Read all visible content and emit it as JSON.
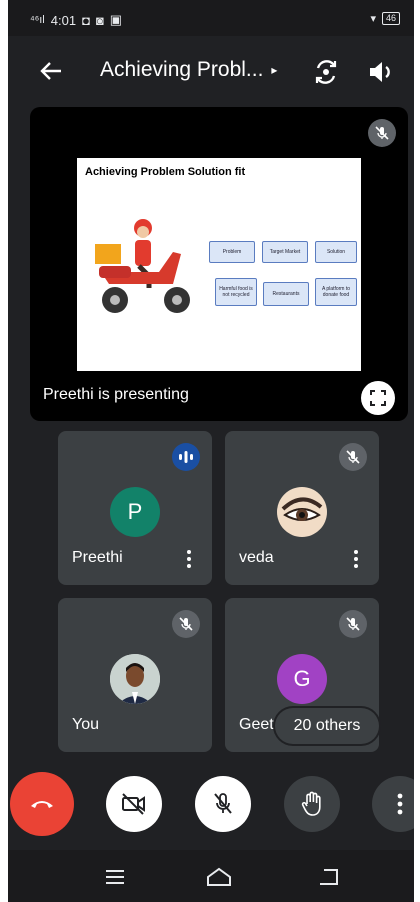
{
  "status_bar": {
    "time": "4:01",
    "signal": "⁴⁶ıl",
    "battery": "46"
  },
  "app_bar": {
    "title": "Achieving Probl...",
    "caret": "▸"
  },
  "presentation": {
    "presenting_label": "Preethi is presenting",
    "slide": {
      "title": "Achieving Problem Solution fit",
      "boxes": [
        "Problem",
        "Target Market",
        "Solution",
        "Harmful food is not recycled",
        "Restaurants",
        "A platform to donate food"
      ]
    }
  },
  "participants": [
    {
      "name": "Preethi",
      "initial": "P",
      "color": "#128269"
    },
    {
      "name": "veda"
    },
    {
      "name": "You"
    },
    {
      "name": "Geet",
      "initial": "G",
      "color": "#a142c4"
    }
  ],
  "others_label": "20 others",
  "colors": {
    "end_call": "#ea4335",
    "background": "#202124",
    "tile": "#3c4043"
  }
}
